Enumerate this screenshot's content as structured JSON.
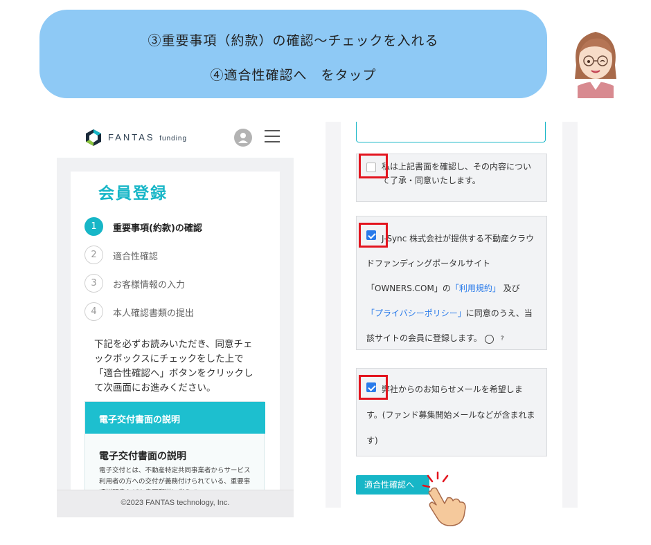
{
  "banner": {
    "line1": "③重要事項（約款）の確認〜チェックを入れる",
    "line2": "④適合性確認へ　をタップ"
  },
  "left_phone": {
    "logo_text": "FANTAS",
    "logo_sub": "funding",
    "page_title": "会員登録",
    "steps": [
      {
        "num": "1",
        "label": "重要事項(約款)の確認"
      },
      {
        "num": "2",
        "label": "適合性確認"
      },
      {
        "num": "3",
        "label": "お客様情報の入力"
      },
      {
        "num": "4",
        "label": "本人確認書類の提出"
      }
    ],
    "intro": "下記を必ずお読みいただき、同意チェックボックスにチェックをした上で「適合性確認へ」ボタンをクリックして次画面にお進みください。",
    "section_header": "電子交付書面の説明",
    "section_subtitle": "電子交付書面の説明",
    "section_body": "電子交付とは、不動産特定共同事業者からサービス利用者の方への交付が義務付けられている、重要事項説明書などを書面郵送に代えて",
    "footer": "©2023 FANTAS technology, Inc."
  },
  "right_phone": {
    "agree1": "私は上記書面を確認し、その内容について了承・同意いたします。",
    "agree2": {
      "part1": "J-Sync 株式会社が提供する不動産クラウドファンディングポータルサイト「OWNERS.COM」の",
      "link1": "「利用規約」",
      "part2": "及び",
      "link2": "「プライバシーポリシー」",
      "part3": "に同意のうえ、当該サイトの会員に登録します。",
      "help": "?"
    },
    "agree3": "弊社からのお知らせメールを希望します。(ファンド募集開始メールなどが含まれます)",
    "next_button": "適合性確認へ"
  },
  "colors": {
    "banner": "#8ec9f5",
    "accent": "#17b6c7",
    "checkbox": "#2a7bea",
    "highlight": "#e3141e"
  }
}
